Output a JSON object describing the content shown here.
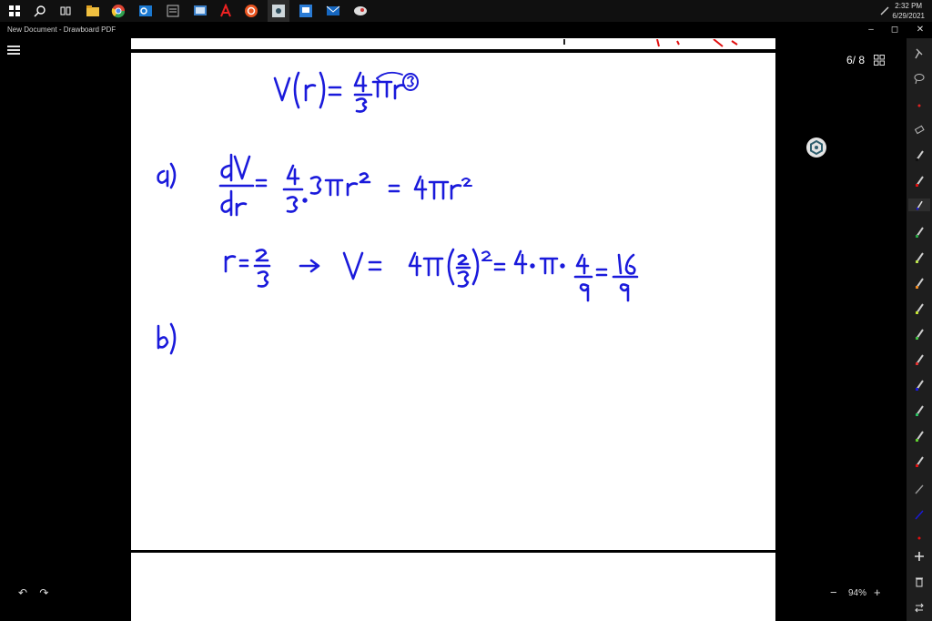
{
  "taskbar": {
    "time": "2:32 PM",
    "date": "6/29/2021",
    "apps": [
      "windows-start",
      "search",
      "task-view",
      "file-explorer",
      "chrome",
      "outlook",
      "app",
      "app",
      "acrobat",
      "ubuntu",
      "drawboard",
      "app",
      "mail",
      "app"
    ]
  },
  "window": {
    "title": "New Document - Drawboard PDF",
    "minimize": "–",
    "restore": "◻",
    "close": "✕"
  },
  "viewer": {
    "page_indicator": "6/ 8",
    "zoom_minus": "−",
    "zoom_level": "94%",
    "zoom_plus": "+",
    "undo": "↶",
    "redo": "↷"
  },
  "handwriting": {
    "line_volume": "V(r) = 4/3 π r³",
    "part_a_label": "a)",
    "line_derivative": "dV/dr = 4/3 · 3 π r² = 4π r²",
    "line_substitute": "r = 2/3 → V = 4π (2/3)² = 4 · π · 4/9 = 16/9",
    "part_b_label": "b)"
  },
  "colors": {
    "ink": "#1a1adb",
    "red_ink": "#e01010",
    "page": "#ffffff",
    "background": "#000000"
  },
  "icons": {
    "menu": "hamburger-icon",
    "grid": "grid-view-icon",
    "extension": "hexagon-icon",
    "undo": "undo-icon",
    "redo": "redo-icon",
    "toolbar": [
      "pin-icon",
      "lasso-icon",
      "ruler-icon",
      "eraser-icon",
      "pen-icon",
      "highlighter-icon"
    ]
  }
}
